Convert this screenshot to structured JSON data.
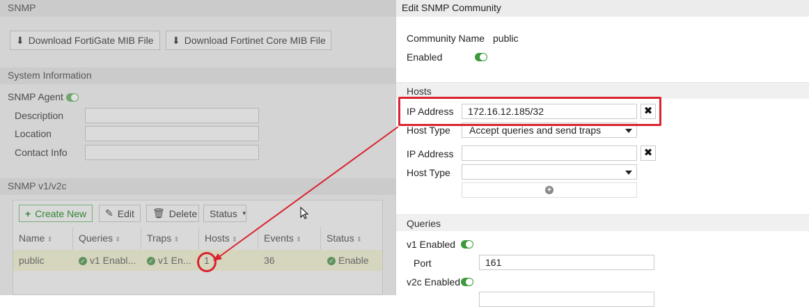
{
  "left": {
    "snmp_header": "SNMP",
    "download_fortigate": "Download FortiGate MIB File",
    "download_core": "Download Fortinet Core MIB File",
    "system_info_header": "System Information",
    "snmp_agent_label": "SNMP Agent",
    "description_label": "Description",
    "location_label": "Location",
    "contact_label": "Contact Info",
    "v1v2c_header": "SNMP v1/v2c",
    "toolbar": {
      "create_new": "Create New",
      "edit": "Edit",
      "delete": "Delete",
      "status": "Status"
    },
    "columns": [
      "Name",
      "Queries",
      "Traps",
      "Hosts",
      "Events",
      "Status"
    ],
    "row": {
      "name": "public",
      "queries": "v1 Enabl...",
      "traps": "v1 En...",
      "hosts": "1",
      "events": "36",
      "status": "Enable"
    }
  },
  "right": {
    "title": "Edit SNMP Community",
    "community_name_label": "Community Name",
    "community_name_value": "public",
    "enabled_label": "Enabled",
    "hosts_header": "Hosts",
    "host1": {
      "ip_label": "IP Address",
      "ip_value": "172.16.12.185/32",
      "type_label": "Host Type",
      "type_value": "Accept queries and send traps"
    },
    "host2": {
      "ip_label": "IP Address",
      "ip_value": "",
      "type_label": "Host Type",
      "type_value": ""
    },
    "queries_header": "Queries",
    "v1_enabled_label": "v1 Enabled",
    "port_label": "Port",
    "port_value": "161",
    "v2c_enabled_label": "v2c Enabled"
  },
  "annotation_color": "#d9232e",
  "accent_green": "#3c9a3c"
}
